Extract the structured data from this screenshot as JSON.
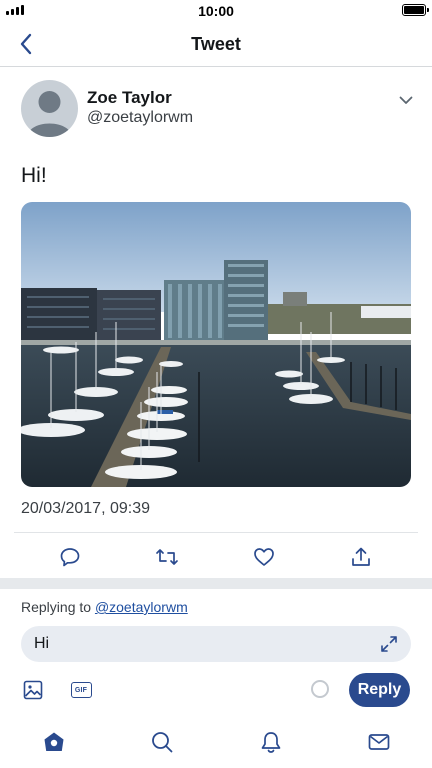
{
  "status_bar": {
    "time": "10:00",
    "signal_icon": "signal-bars-icon",
    "battery_icon": "battery-full-icon"
  },
  "nav": {
    "title": "Tweet",
    "back_icon": "chevron-left-icon"
  },
  "tweet": {
    "author_name": "Zoe Taylor",
    "author_handle": "@zoetaylorwm",
    "text": "Hi!",
    "timestamp": "20/03/2017, 09:39",
    "image_icon": "photo-marina-icon"
  },
  "actions": [
    "reply-icon",
    "retweet-icon",
    "like-icon",
    "share-icon"
  ],
  "reply": {
    "replying_prefix": "Replying to",
    "replying_handle": "@zoetaylorwm",
    "input_value": "Hi",
    "gif_label": "GIF",
    "button_label": "Reply"
  },
  "tabs": [
    "home-icon",
    "search-icon",
    "notifications-icon",
    "messages-icon"
  ],
  "colors": {
    "accent": "#2a4a8e",
    "field_bg": "#e8ecf2",
    "separator_band": "#e6e9ec"
  }
}
